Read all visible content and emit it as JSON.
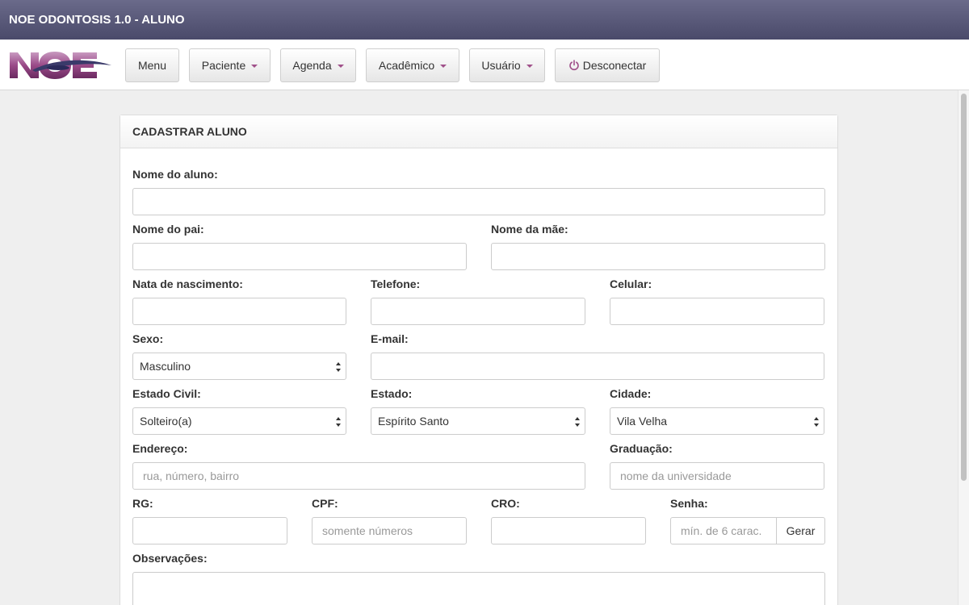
{
  "app": {
    "title": "NOE ODONTOSIS 1.0 - ALUNO"
  },
  "nav": {
    "menu": "Menu",
    "paciente": "Paciente",
    "agenda": "Agenda",
    "academico": "Acadêmico",
    "usuario": "Usuário",
    "desconectar": "Desconectar"
  },
  "form": {
    "title": "CADASTRAR ALUNO",
    "labels": {
      "nome_aluno": "Nome do aluno:",
      "nome_pai": "Nome do pai:",
      "nome_mae": "Nome da mãe:",
      "nascimento": "Nata de nascimento:",
      "telefone": "Telefone:",
      "celular": "Celular:",
      "sexo": "Sexo:",
      "email": "E-mail:",
      "estado_civil": "Estado Civil:",
      "estado": "Estado:",
      "cidade": "Cidade:",
      "endereco": "Endereço:",
      "graduacao": "Graduação:",
      "rg": "RG:",
      "cpf": "CPF:",
      "cro": "CRO:",
      "senha": "Senha:",
      "observacoes": "Observações:"
    },
    "selects": {
      "sexo": "Masculino",
      "estado_civil": "Solteiro(a)",
      "estado": "Espírito Santo",
      "cidade": "Vila Velha"
    },
    "placeholders": {
      "endereco": "rua, número, bairro",
      "graduacao": "nome da universidade",
      "cpf": "somente números",
      "senha": "mín. de 6 carac."
    },
    "gerar": "Gerar"
  },
  "colors": {
    "accent": "#a0508a",
    "titlebar": "#4a4a6a"
  }
}
